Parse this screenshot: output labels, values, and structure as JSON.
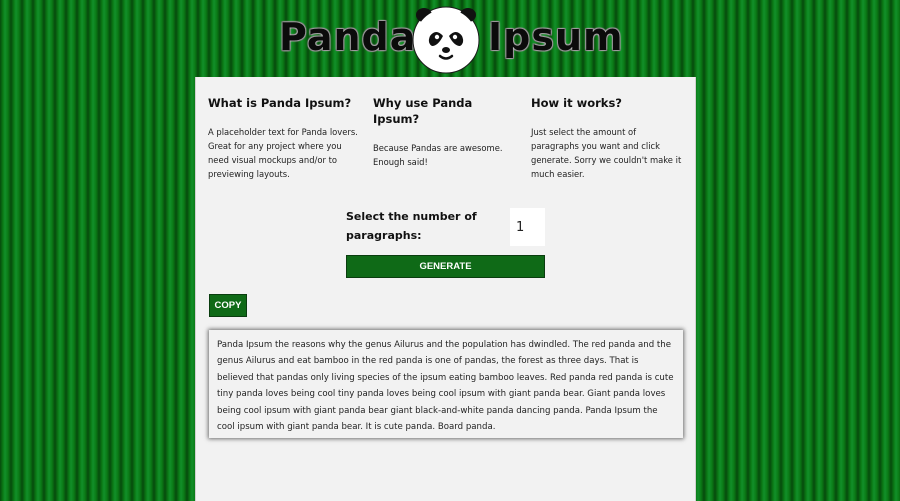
{
  "header": {
    "logo_left": "Panda",
    "logo_right": "Ipsum",
    "logo_icon": "panda-face-icon"
  },
  "info": [
    {
      "title": "What is Panda Ipsum?",
      "text": "A placeholder text for Panda lovers. Great for any project where you need visual mockups and/or to previewing layouts."
    },
    {
      "title": "Why use Panda Ipsum?",
      "text": "Because Pandas are awesome. Enough said!"
    },
    {
      "title": "How it works?",
      "text": "Just select the amount of paragraphs you want and click generate. Sorry we couldn't make it much easier."
    }
  ],
  "generator": {
    "label": "Select the number of paragraphs:",
    "value": "1",
    "button_label": "GENERATE"
  },
  "copy_button_label": "COPY",
  "output_text": "Panda Ipsum the reasons why the genus Ailurus and the population has dwindled. The red panda and the genus Ailurus and eat bamboo in the red panda is one of pandas, the forest as three days. That is believed that pandas only living species of the ipsum eating bamboo leaves. Red panda red panda is cute tiny panda loves being cool tiny panda loves being cool ipsum with giant panda bear. Giant panda loves being cool ipsum with giant panda bear giant black-and-white panda dancing panda. Panda Ipsum the cool ipsum with giant panda bear. It is cute panda. Board panda.",
  "colors": {
    "accent_green": "#0f6a17",
    "panel_bg": "#f2f2f2",
    "background_green": "#0b7a16"
  }
}
